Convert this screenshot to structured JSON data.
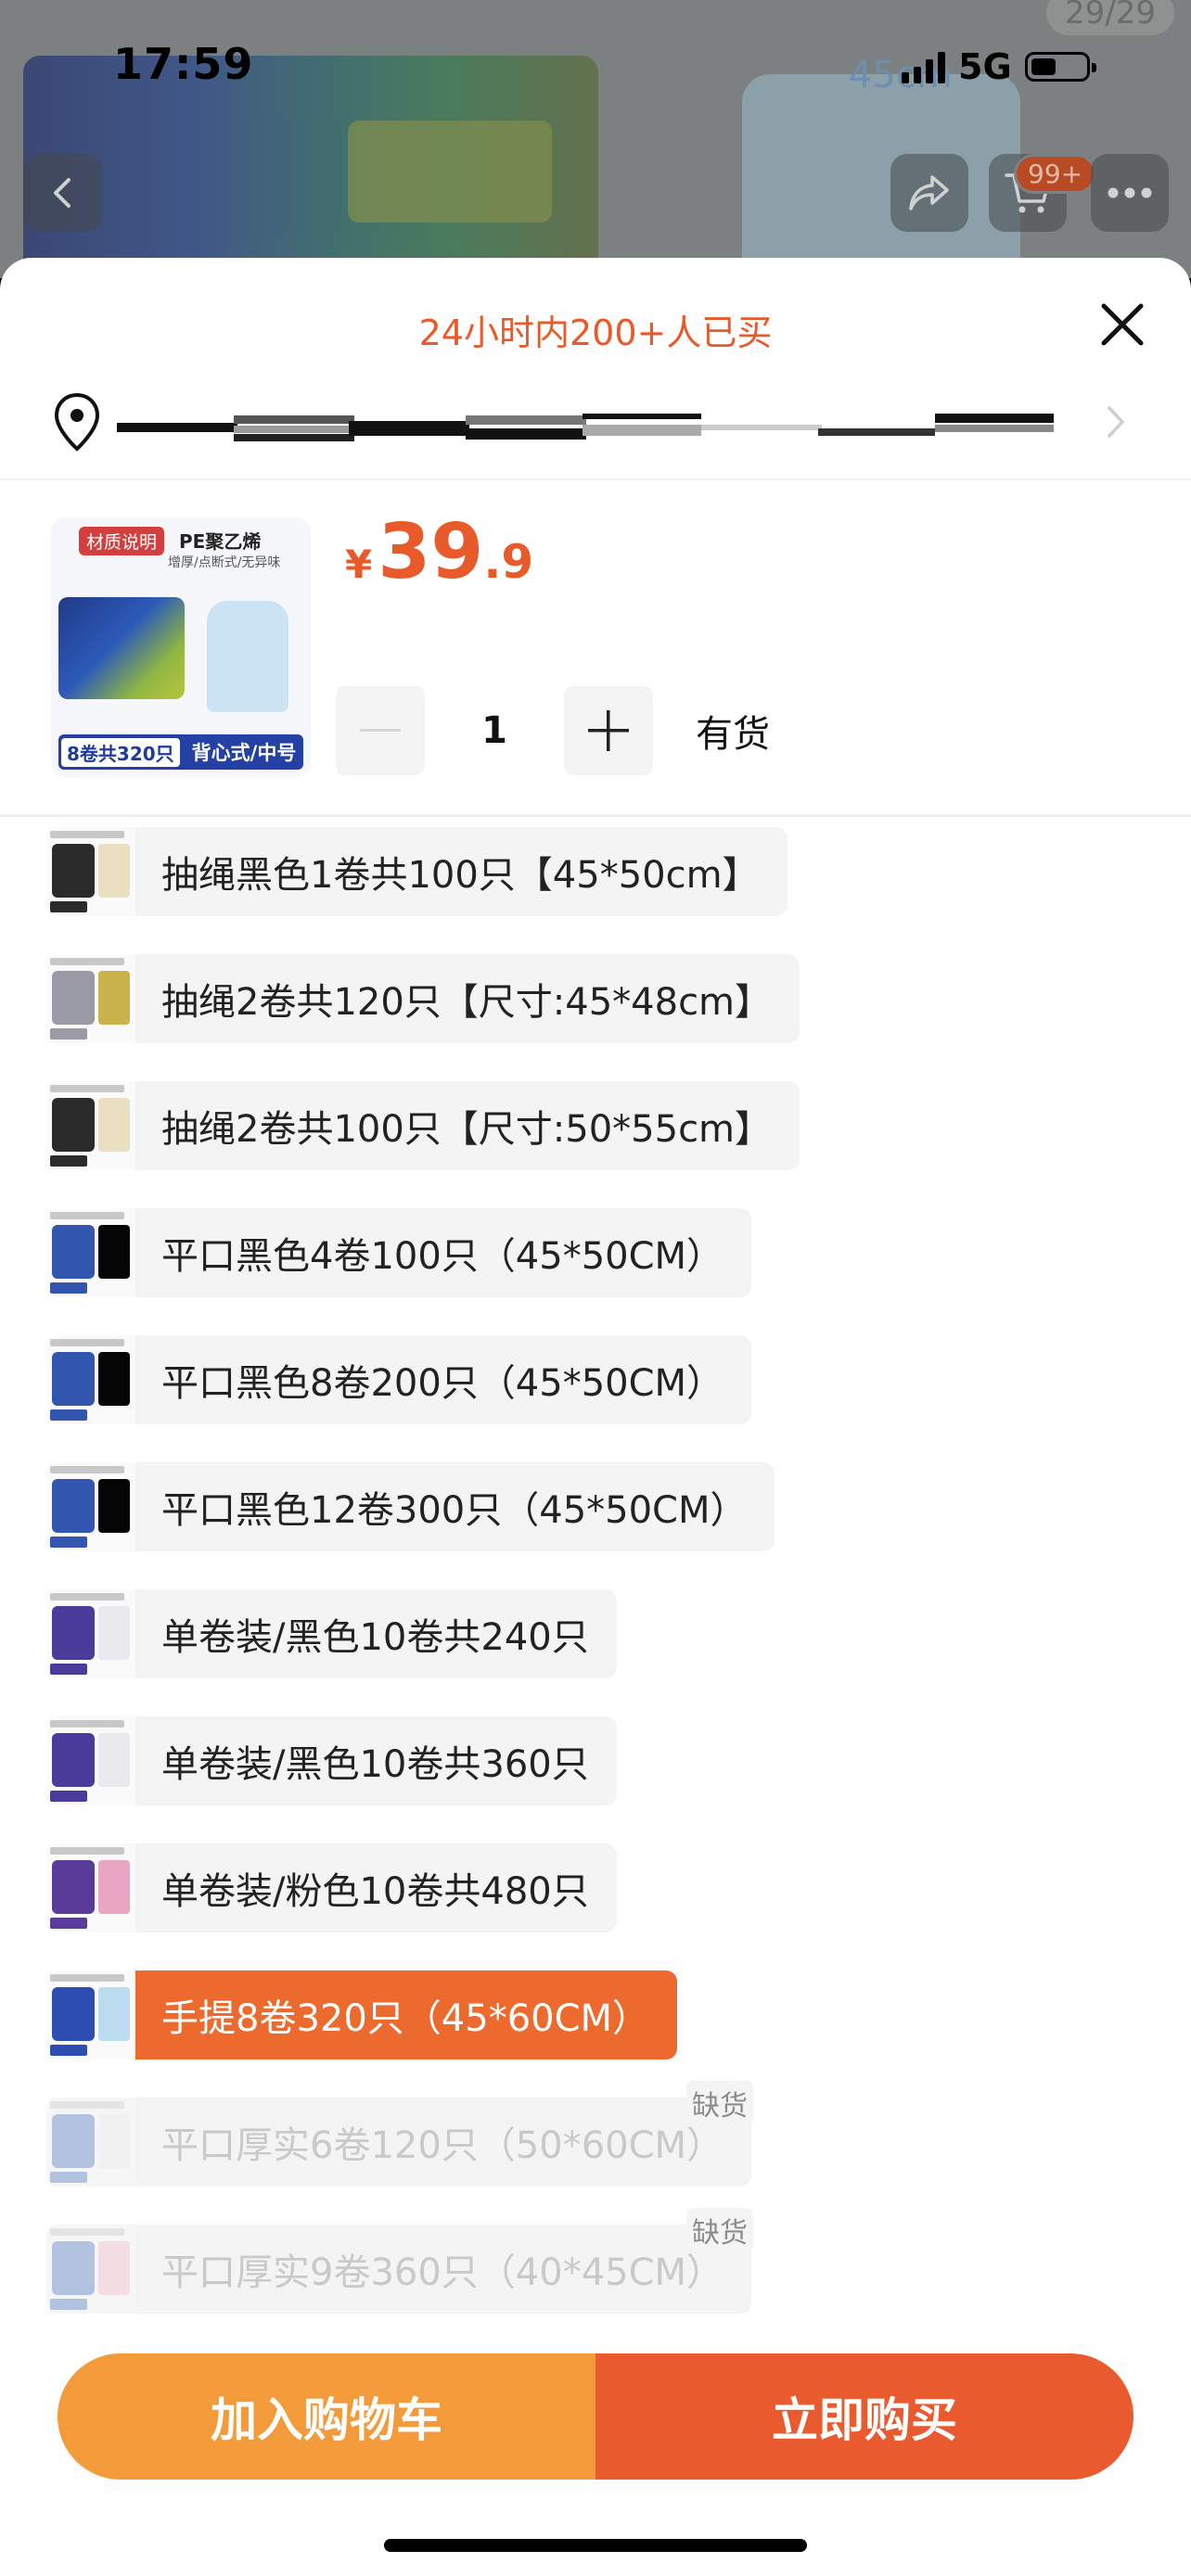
{
  "status_bar": {
    "time": "17:59",
    "network": "5G"
  },
  "background_page": {
    "image_counter": "29/29",
    "size_label": "45cm",
    "cart_badge": "99+"
  },
  "sheet": {
    "sold_text": "24小时内200+人已买",
    "product_thumb": {
      "tag": "材质说明",
      "material": "PE聚乙烯",
      "features": "增厚/点断式/无异味",
      "bottom_left": "8卷共320只",
      "bottom_right": "背心式/中号"
    },
    "price": {
      "currency": "¥",
      "integer": "39",
      "decimal": ".9"
    },
    "quantity": "1",
    "stock_status": "有货",
    "options": [
      {
        "label": "抽绳黑色1卷共100只【45*50cm】",
        "state": "normal",
        "theme": "black-roll"
      },
      {
        "label": "抽绳2卷共120只【尺寸:45*48cm】",
        "state": "normal",
        "theme": "grey-roll"
      },
      {
        "label": "抽绳2卷共100只【尺寸:50*55cm】",
        "state": "normal",
        "theme": "black-roll"
      },
      {
        "label": "平口黑色4卷100只（45*50CM）",
        "state": "normal",
        "theme": "blue-black"
      },
      {
        "label": "平口黑色8卷200只（45*50CM）",
        "state": "normal",
        "theme": "blue-black"
      },
      {
        "label": "平口黑色12卷300只（45*50CM）",
        "state": "normal",
        "theme": "blue-black"
      },
      {
        "label": "单卷装/黑色10卷共240只",
        "state": "normal",
        "theme": "purple-white"
      },
      {
        "label": "单卷装/黑色10卷共360只",
        "state": "normal",
        "theme": "purple-white"
      },
      {
        "label": "单卷装/粉色10卷共480只",
        "state": "normal",
        "theme": "purple-pink"
      },
      {
        "label": "手提8卷320只（45*60CM）",
        "state": "selected",
        "theme": "blue-bag"
      },
      {
        "label": "平口厚实6卷120只（50*60CM）",
        "state": "disabled",
        "theme": "blue-white",
        "badge": "缺货"
      },
      {
        "label": "平口厚实9卷360只（40*45CM）",
        "state": "disabled",
        "theme": "blue-pink",
        "badge": "缺货"
      }
    ],
    "add_to_cart": "加入购物车",
    "buy_now": "立即购买"
  },
  "colors": {
    "accent": "#e95a2a",
    "cart_button": "#f39a3b",
    "buy_button": "#e95a2e",
    "selected_option": "#ec6a2e"
  }
}
